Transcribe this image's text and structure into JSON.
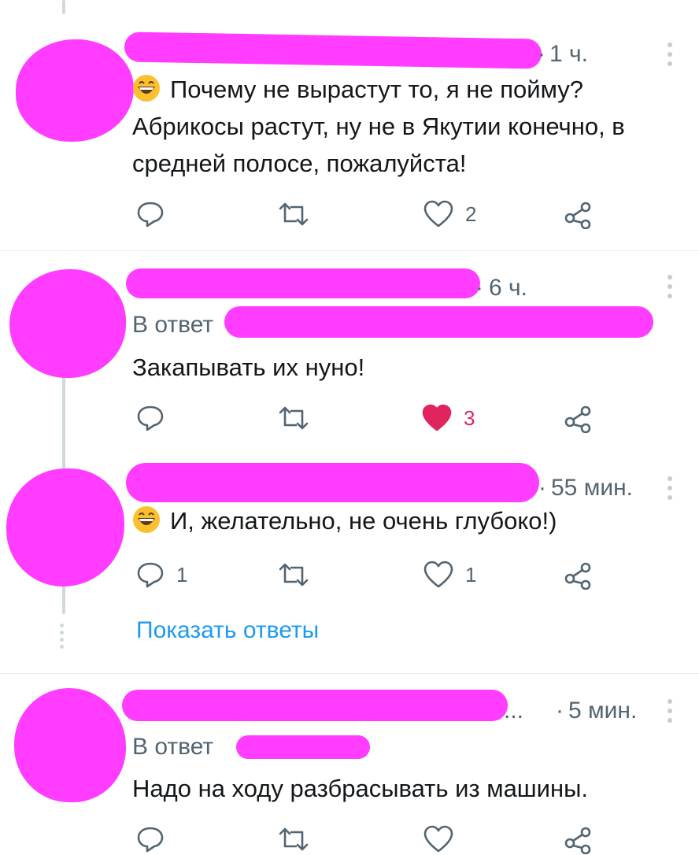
{
  "tweets": [
    {
      "time": "1 ч.",
      "text_lines": [
        "Почему не вырастут то,  я не пойму?",
        "Абрикосы растут, ну не в Якутии конечно, в",
        "средней полосе, пожалуйста!"
      ],
      "actions": {
        "reply_count": "",
        "retweet_count": "",
        "like_count": "2",
        "liked": false
      }
    },
    {
      "time": "6 ч.",
      "reply_to": "В ответ",
      "text_lines": [
        "Закапывать их  нуно!"
      ],
      "actions": {
        "reply_count": "",
        "retweet_count": "",
        "like_count": "3",
        "liked": true
      }
    },
    {
      "time": "55 мин.",
      "text_lines": [
        "И, желательно, не очень глубоко!)"
      ],
      "actions": {
        "reply_count": "1",
        "retweet_count": "",
        "like_count": "1",
        "liked": false
      }
    },
    {
      "time": "5 мин.",
      "name_ellipsis": "...",
      "reply_to": "В ответ",
      "text_lines": [
        "Надо на ходу разбрасывать из машины."
      ],
      "actions": {
        "reply_count": "",
        "retweet_count": "",
        "like_count": "",
        "liked": false
      }
    }
  ],
  "show_replies_label": "Показать ответы",
  "colors": {
    "accent": "#1d9bf0",
    "like": "#e0245e",
    "redaction": "#ff3cff",
    "muted": "#536471"
  },
  "icons": [
    "reply-icon",
    "retweet-icon",
    "like-icon",
    "share-icon",
    "more-icon",
    "grinning-emoji"
  ]
}
